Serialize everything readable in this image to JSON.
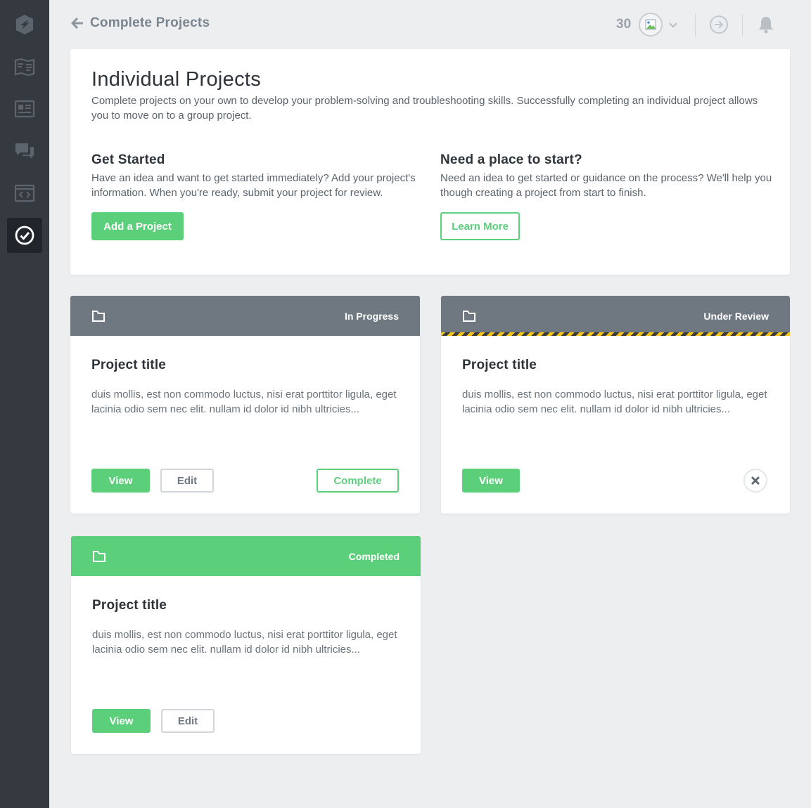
{
  "header": {
    "back_label": "Complete Projects",
    "points": "30"
  },
  "intro": {
    "title": "Individual Projects",
    "lead": "Complete projects on your own to develop your problem-solving and troubleshooting skills. Successfully completing an individual project allows you to move on to a group project.",
    "get_started": {
      "heading": "Get Started",
      "text": "Have an idea and want to get started immediately? Add your project's information. When you're ready, submit your project for review.",
      "button": "Add a Project"
    },
    "need_place": {
      "heading": "Need a place to start?",
      "text": "Need an idea to get started or guidance on the process? We'll help you though creating a project from start to finish.",
      "button": "Learn More"
    }
  },
  "projects": [
    {
      "status": "In Progress",
      "title": "Project title",
      "description": "duis mollis, est non commodo luctus, nisi erat porttitor ligula, eget lacinia odio sem nec elit. nullam id dolor id nibh ultricies...",
      "view_label": "View",
      "edit_label": "Edit",
      "complete_label": "Complete"
    },
    {
      "status": "Under Review",
      "title": "Project title",
      "description": "duis mollis, est non commodo luctus, nisi erat porttitor ligula, eget lacinia odio sem nec elit. nullam id dolor id nibh ultricies...",
      "view_label": "View"
    },
    {
      "status": "Completed",
      "title": "Project title",
      "description": "duis mollis, est non commodo luctus, nisi erat porttitor ligula, eget lacinia odio sem nec elit. nullam id dolor id nibh ultricies...",
      "view_label": "View",
      "edit_label": "Edit"
    }
  ],
  "icons": {
    "sidebar": [
      "logo-icon",
      "map-icon",
      "news-icon",
      "chat-icon",
      "code-icon",
      "check-circle-icon"
    ],
    "header": [
      "back-arrow-icon",
      "avatar-image-icon",
      "chevron-down-icon",
      "arrow-circle-icon",
      "bell-icon"
    ]
  },
  "colors": {
    "sidebar": "#343a40",
    "sidebar_active": "#212529",
    "accent_green": "#5ccf7b",
    "status_gray": "#6f7881",
    "hazard_yellow": "#f5c518",
    "page_bg": "#eceef0"
  }
}
